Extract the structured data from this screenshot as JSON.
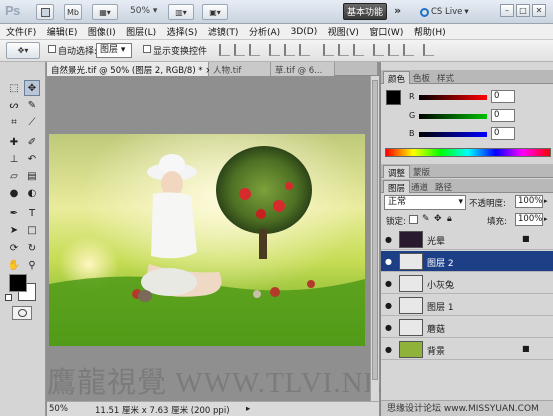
{
  "appbar": {
    "logo": "Ps",
    "mb_label": "Mb",
    "zoom": "50%",
    "workspace": "基本功能",
    "more": "»",
    "cslive": "CS Live",
    "cslive_arrow": "▾"
  },
  "menu": [
    "文件(F)",
    "编辑(E)",
    "图像(I)",
    "图层(L)",
    "选择(S)",
    "滤镜(T)",
    "分析(A)",
    "3D(D)",
    "视图(V)",
    "窗口(W)",
    "帮助(H)"
  ],
  "options": {
    "autoselect_label": "自动选择:",
    "autoselect_value": "图层",
    "show_transform": "显示变换控件"
  },
  "document": {
    "tabs": [
      "自然景光.tif @ 50% (图层 2, RGB/8) * ×",
      "人物.tif",
      "草.tif @ 6..."
    ],
    "status_zoom": "50%",
    "status_size": "11.51 厘米 x 7.63 厘米 (200 ppi)"
  },
  "color_panel": {
    "tabs": [
      "颜色",
      "色板",
      "样式"
    ],
    "channels": [
      {
        "label": "R",
        "value": "0",
        "color": "#ff0000"
      },
      {
        "label": "G",
        "value": "0",
        "color": "#00b000"
      },
      {
        "label": "B",
        "value": "0",
        "color": "#0000ff"
      }
    ]
  },
  "adjust_panel": {
    "tabs": [
      "调整",
      "蒙版"
    ]
  },
  "layers_panel": {
    "tabs": [
      "图层",
      "通道",
      "路径"
    ],
    "blend_mode": "正常",
    "opacity_label": "不透明度:",
    "opacity_value": "100%",
    "lock_label": "锁定:",
    "fill_label": "填充:",
    "fill_value": "100%",
    "layers": [
      {
        "name": "光晕",
        "selected": false,
        "locked": true,
        "thumb": "#2a1a30"
      },
      {
        "name": "图层 2",
        "selected": true,
        "locked": false,
        "thumb": "#e8e8e8"
      },
      {
        "name": "小灰兔",
        "selected": false,
        "locked": false,
        "thumb": "#e8e8e8"
      },
      {
        "name": "图层 1",
        "selected": false,
        "locked": false,
        "thumb": "#e8e8e8"
      },
      {
        "name": "蘑菇",
        "selected": false,
        "locked": false,
        "thumb": "#e8e8e8"
      },
      {
        "name": "背景",
        "selected": false,
        "locked": true,
        "thumb": "#8fb23a"
      }
    ]
  },
  "watermark": {
    "text": "鷹龍視覺 WWW.TLVI.NET",
    "credit": "思缘设计论坛 www.MISSYUAN.COM"
  },
  "colors": {
    "selection": "#1c3f86",
    "foreground": "#000000",
    "background": "#ffffff"
  }
}
